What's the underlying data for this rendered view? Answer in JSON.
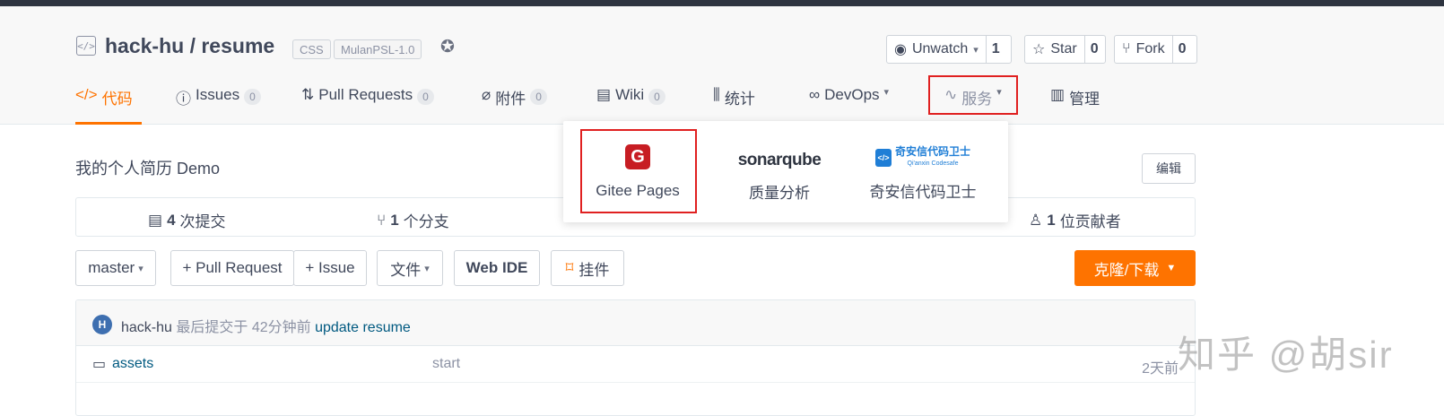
{
  "repo": {
    "owner": "hack-hu",
    "separator": " / ",
    "name": "resume",
    "tags": [
      "CSS",
      "MulanPSL-1.0"
    ],
    "description": "我的个人简历 Demo",
    "edit_label": "编辑"
  },
  "actions": {
    "watch": {
      "label": "Unwatch",
      "count": "1"
    },
    "star": {
      "label": "Star",
      "count": "0"
    },
    "fork": {
      "label": "Fork",
      "count": "0"
    }
  },
  "tabs": [
    {
      "label": "代码",
      "icon": "code-icon",
      "active": true
    },
    {
      "label": "Issues",
      "count": "0",
      "icon": "issue-icon"
    },
    {
      "label": "Pull Requests",
      "count": "0",
      "icon": "pr-icon"
    },
    {
      "label": "附件",
      "count": "0",
      "icon": "paperclip-icon"
    },
    {
      "label": "Wiki",
      "count": "0",
      "icon": "book-icon"
    },
    {
      "label": "统计",
      "icon": "bar-chart-icon"
    },
    {
      "label": "DevOps",
      "icon": "infinity-icon"
    },
    {
      "label": "服务",
      "icon": "pulse-icon"
    },
    {
      "label": "管理",
      "icon": "settings-doc-icon"
    }
  ],
  "services_dropdown": [
    {
      "logo_text": "G",
      "label": "Gitee Pages"
    },
    {
      "logo_text": "sonarqube",
      "label": "质量分析"
    },
    {
      "logo_text": "奇安信代码卫士",
      "logo_sub": "Qi'anxin Codesafe",
      "label": "奇安信代码卫士"
    }
  ],
  "stats": {
    "commits": {
      "num": "4",
      "label": "次提交"
    },
    "branches": {
      "num": "1",
      "label": "个分支"
    },
    "contributors": {
      "num": "1",
      "label": "位贡献者"
    }
  },
  "toolbar": {
    "branch": "master",
    "pull_request": "+ Pull Request",
    "issue": "+ Issue",
    "file": "文件",
    "web_ide": "Web IDE",
    "widget": "挂件",
    "clone": "克隆/下载"
  },
  "latest_commit": {
    "avatar_letter": "H",
    "author": "hack-hu",
    "meta": "最后提交于 42分钟前",
    "message": "update resume"
  },
  "files": [
    {
      "name": "assets",
      "commit": "start",
      "time": "2天前",
      "type": "folder"
    }
  ],
  "watermark": "知乎 @胡sir",
  "colors": {
    "accent": "#fe7300",
    "highlight_box": "#e02020",
    "link": "#005980"
  }
}
